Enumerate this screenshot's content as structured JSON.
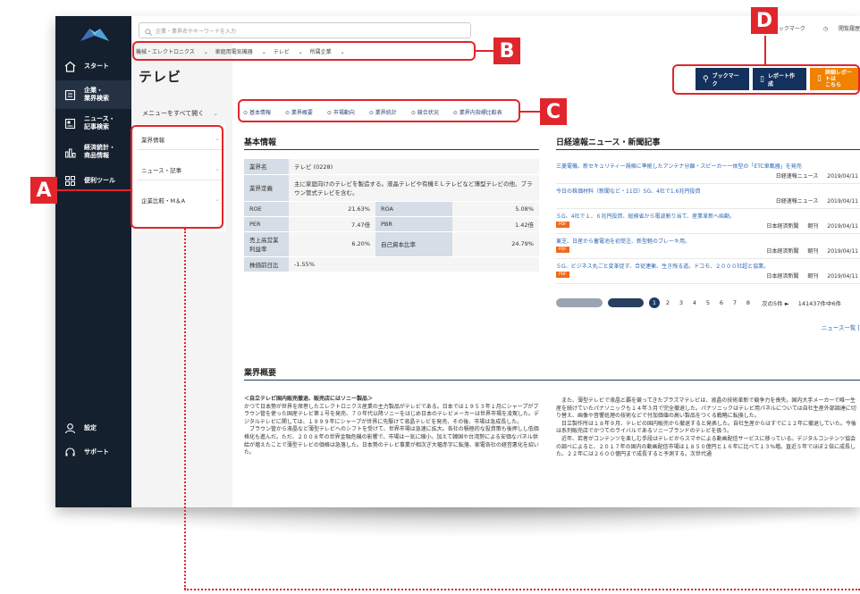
{
  "search": {
    "placeholder": "企業・業界名やキーワードを入力"
  },
  "top_links": [
    "ブックマーク",
    "閲覧履歴"
  ],
  "sidebar": {
    "items": [
      {
        "icon": "home-icon",
        "label": "スタート"
      },
      {
        "icon": "company-icon",
        "label": "企業・\n業界検索"
      },
      {
        "icon": "news-icon",
        "label": "ニュース・\n記事検索"
      },
      {
        "icon": "stats-icon",
        "label": "経済統計・\n商品情報"
      },
      {
        "icon": "tools-icon",
        "label": "便利ツール"
      },
      {
        "icon": "settings-icon",
        "label": "設定"
      },
      {
        "icon": "support-icon",
        "label": "サポート"
      }
    ]
  },
  "breadcrumb": [
    "機械・エレクトロニクス",
    "家庭用電気機器",
    "テレビ",
    "所属企業"
  ],
  "page_title": "テレビ",
  "actions": {
    "bookmark": "ブックマーク",
    "report": "レポート作成",
    "detail": "詳細レポートは\nこちら"
  },
  "menu": {
    "show_all": "メニューをすべて開く",
    "items": [
      "業界情報",
      "ニュース・記事",
      "企業比較・M＆A"
    ]
  },
  "anchors": [
    "基本情報",
    "業界概要",
    "市場動向",
    "業界統計",
    "競合状況",
    "業界内指標比較表"
  ],
  "basic_info": {
    "title": "基本情報",
    "industry_name_label": "業界名",
    "industry_name": "テレビ (0228)",
    "definition_label": "業界定義",
    "definition": "主に家庭向けのテレビを製造する。液晶テレビや有機ＥＬテレビなど薄型テレビの他、ブラウン管式テレビを含む。",
    "rows": [
      {
        "l1": "ROE",
        "v1": "21.63%",
        "l2": "ROA",
        "v2": "5.08%"
      },
      {
        "l1": "PER",
        "v1": "7.47倍",
        "l2": "PBR",
        "v2": "1.42倍"
      },
      {
        "l1": "売上高営業利益率",
        "v1": "6.20%",
        "l2": "自己資本比率",
        "v2": "24.79%"
      }
    ],
    "change_label": "株価前日比",
    "change_value": "-1.55%"
  },
  "news": {
    "title": "日経速報ニュース・新聞記事",
    "items": [
      {
        "text": "三菱電機、新セキュリティー規格に準拠したアンテナ分離・スピーカー一体型の「ETC車載器」を発売",
        "pdf": false,
        "source": "日経速報ニュース",
        "paper": "",
        "date": "2019/04/11"
      },
      {
        "text": "今日の株価材料（新聞など・11日）5G、4社で1.6兆円投資",
        "pdf": false,
        "source": "日経速報ニュース",
        "paper": "",
        "date": "2019/04/11"
      },
      {
        "text": "５G、4社で１．６兆円投資、総務省から電波割り当て、産業革新へ始動。",
        "pdf": true,
        "source": "日本経済新聞",
        "paper": "朝刊",
        "date": "2019/04/11"
      },
      {
        "text": "東芝、日産から蓄電池を初受注、新型軽のブレーキ用。",
        "pdf": true,
        "source": "日本経済新聞",
        "paper": "朝刊",
        "date": "2019/04/11"
      },
      {
        "text": "５G、ビジネス丸ごと変革促す、合従連衡、生き残る道。ドコモ、２０００社超と協業。",
        "pdf": true,
        "source": "日本経済新聞",
        "paper": "朝刊",
        "date": "2019/04/11"
      }
    ],
    "pdf_label": "PDF",
    "pages": [
      "1",
      "2",
      "3",
      "4",
      "5",
      "6",
      "7",
      "8"
    ],
    "next_label": "次の5件 ►",
    "total": "141437件中6件",
    "more": "ニュース一覧 [ "
  },
  "overview": {
    "title": "業界概要",
    "heading": "＜自立テレビ国内販売撤退、販売店にはソニー製品＞",
    "left_text": "かつて日本勢が世界を席巻したエレクトロニクス産業の主力製品がテレビである。日本では１９５３年１月にシャープがブラウン管を使った国産テレビ第１号を発売、７０年代以降ソニーをはじめ日本のテレビメーカーは世界市場を凌駕した。デジタルテレビに関しては、１９９９年にシャープが世界に先駆けて液晶テレビを発売、その後、市場は急成長した。\n　ブラウン管から液晶など薄型テレビへのシフトを受けて、世界市場は急速に拡大。各社の積極的な投資策も後押しし低価格化も進んだ。ただ、２００８年の世界金融危機の影響で、市場は一気に縮小。加えて韓国や台湾勢による安価なパネル供給が増えたことで薄型テレビの価格は急落した。日本勢のテレビ事業が相次ぎ大幅赤字に転落、家電各社の経営悪化を招いた。",
    "right_text": "　また、薄型テレビで液晶と覇を競ってきたプラズマテレビは、液晶の技術革新で競争力を喪失。国内大手メーカーで唯一生産を続けていたパナソニックも１４年３月で完全撤退した。パナソニックはテレビ用パネルについては自社生産外部調達に切り替え、画像や音響処理の技術などで付加価値の高い製品をつくる戦略に転換した。\n　日立製作所は１８年９月、テレビの国内販売から撤退すると発表した。自社生産からはすでに１２年に撤退していた。今後は系列販売店でかつてのライバルであるソニーブランドのテレビを扱う。\n　近年、若者がコンテンツを楽しむ手段はテレビからスマホによる動画配信サービスに移っている。デジタルコンテンツ協会の調べによると、２０１７年の国内の動画配信市場は１８５０億円と１６年に比べて１３%増。直近５年でほぼ２倍に成長した。２２年には２６００億円まで成長すると予測する。次世代通"
  },
  "annotations": [
    "A",
    "B",
    "C",
    "D"
  ],
  "colors": {
    "sidebar": "#15202e",
    "accent_navy": "#14305c",
    "accent_orange": "#f08200",
    "annotation_red": "#e0262c",
    "link": "#2b66b5"
  }
}
